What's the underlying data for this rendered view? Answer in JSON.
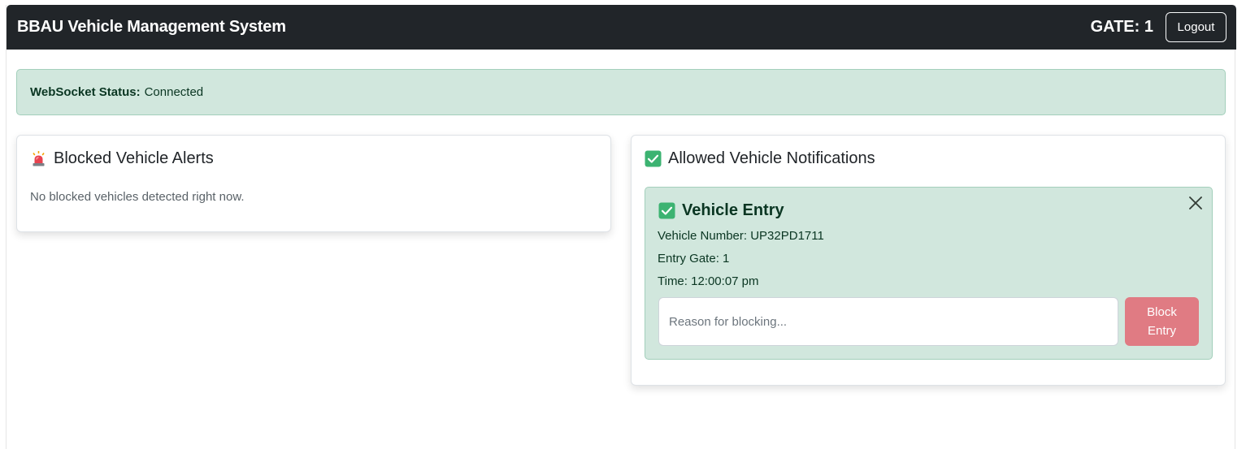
{
  "navbar": {
    "brand": "BBAU Vehicle Management System",
    "gate_label": "GATE: 1",
    "logout_label": "Logout"
  },
  "status": {
    "label": "WebSocket Status:",
    "value": "Connected"
  },
  "blocked_card": {
    "icon": "siren-icon",
    "title": "Blocked Vehicle Alerts",
    "empty_text": "No blocked vehicles detected right now."
  },
  "allowed_card": {
    "icon": "check-box-icon",
    "title": "Allowed Vehicle Notifications",
    "entry": {
      "icon": "check-box-icon",
      "title": "Vehicle Entry",
      "vehicle_number": "Vehicle Number: UP32PD1711",
      "entry_gate": "Entry Gate: 1",
      "time": "Time: 12:00:07 pm",
      "reason_placeholder": "Reason for blocking...",
      "block_label": "Block Entry",
      "close_icon": "close-icon"
    }
  },
  "colors": {
    "navbar_bg": "#212529",
    "success_bg": "#d1e7dd",
    "success_text": "#0a3622",
    "danger_button": "#e07b83",
    "check_green": "#3cb371"
  }
}
